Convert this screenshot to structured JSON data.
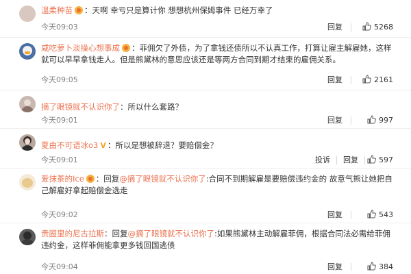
{
  "comments": [
    {
      "user": "温柔种苗",
      "has_badge": true,
      "badge_type": "dot",
      "text": "天啊 幸亏只是算计你 想想杭州保姆事件 已经万幸了",
      "time": "今天09:03",
      "report": "",
      "reply": "回复",
      "likes": "5268",
      "avatar_color": "#d9c8c0"
    },
    {
      "user": "咸吃萝卜淡操心想事成",
      "has_badge": true,
      "badge_type": "dot",
      "text": "菲佣欠了外债，为了拿钱还债所以不认真工作，打算让雇主解雇她，这样就可以早早拿钱走人。但是熊黛林的意思应该还是等两方合同到期才结束的雇佣关系。",
      "time": "今天09:05",
      "report": "",
      "reply": "回复",
      "likes": "2161",
      "avatar_color": "#4a6fa5"
    },
    {
      "user": "摘了眼镜就不认识你了",
      "has_badge": false,
      "badge_type": "",
      "text": "所以什么套路？",
      "time": "今天09:01",
      "report": "",
      "reply": "回复",
      "likes": "997",
      "avatar_color": "#c9b8b0"
    },
    {
      "user": "夏由不可语冰o3",
      "has_badge": true,
      "badge_type": "v",
      "badge_text": "V",
      "text": "所以是想被辞退？要赔偿金？",
      "time": "今天09:01",
      "report": "投诉",
      "reply": "回复",
      "likes": "597",
      "avatar_color": "#b7a9a0"
    },
    {
      "user": "爱抹茶的Ice",
      "has_badge": true,
      "badge_type": "dot",
      "reply_prefix": "回复",
      "reply_target": "@摘了眼镜就不认识你了",
      "text": ":合同不到期解雇是要赔偿违约金的 故意气熊让她把自己解雇好拿起赔偿金选走",
      "time": "今天09:02",
      "report": "",
      "reply": "回复",
      "likes": "543",
      "avatar_color": "#e8d7b8"
    },
    {
      "user": "贵圈里的尼古拉斯",
      "has_badge": false,
      "badge_type": "",
      "reply_prefix": "回复",
      "reply_target": "@摘了眼镜就不认识你了",
      "text": ":如果熊黛林主动解雇菲佣，根据合同法必需给菲佣违约金，这样菲佣能拿更多钱回国逃债",
      "time": "今天09:04",
      "report": "",
      "reply": "回复",
      "likes": "384",
      "avatar_color": "#5a5a5a"
    }
  ]
}
